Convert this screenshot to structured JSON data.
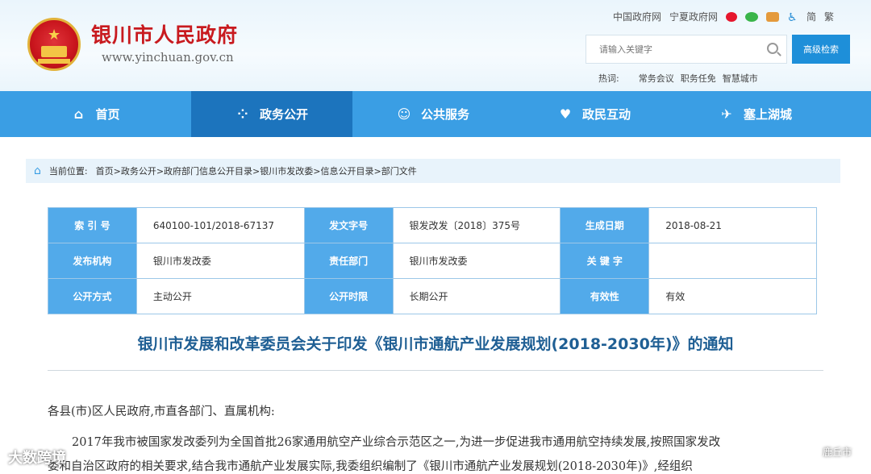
{
  "header": {
    "site_title": "银川市人民政府",
    "site_url": "www.yinchuan.gov.cn",
    "top_links": [
      "中国政府网",
      "宁夏政府网"
    ],
    "lang_simplified": "简",
    "lang_traditional": "繁",
    "search_placeholder": "请输入关键字",
    "advanced_search": "高级检索",
    "hot_label": "热词:",
    "hot_words": [
      "常务会议",
      "职务任免",
      "智慧城市"
    ]
  },
  "nav": {
    "items": [
      {
        "label": "首页",
        "icon": "home-icon"
      },
      {
        "label": "政务公开",
        "icon": "dots-icon",
        "active": true
      },
      {
        "label": "公共服务",
        "icon": "user-icon"
      },
      {
        "label": "政民互动",
        "icon": "heart-hands-icon"
      },
      {
        "label": "塞上湖城",
        "icon": "plane-icon"
      }
    ]
  },
  "breadcrumb": {
    "label": "当前位置:",
    "path": "首页>政务公开>政府部门信息公开目录>银川市发改委>信息公开目录>部门文件"
  },
  "info_table": {
    "rows": [
      [
        {
          "k": "索 引 号",
          "v": "640100-101/2018-67137"
        },
        {
          "k": "发文字号",
          "v": "银发改发〔2018〕375号"
        },
        {
          "k": "生成日期",
          "v": "2018-08-21"
        }
      ],
      [
        {
          "k": "发布机构",
          "v": "银川市发改委"
        },
        {
          "k": "责任部门",
          "v": "银川市发改委"
        },
        {
          "k": "关 键 字",
          "v": ""
        }
      ],
      [
        {
          "k": "公开方式",
          "v": "主动公开"
        },
        {
          "k": "公开时限",
          "v": "长期公开"
        },
        {
          "k": "有效性",
          "v": "有效"
        }
      ]
    ]
  },
  "document": {
    "title": "银川市发展和改革委员会关于印发《银川市通航产业发展规划(2018-2030年)》的通知",
    "salutation": "各县(市)区人民政府,市直各部门、直属机构:",
    "para1": "2017年我市被国家发改委列为全国首批26家通用航空产业综合示范区之一,为进一步促进我市通用航空持续发展,按照国家发改",
    "para2": "委和自治区政府的相关要求,结合我市通航产业发展实际,我委组织编制了《银川市通航产业发展规划(2018-2030年)》,经组织"
  },
  "watermarks": {
    "left": "大数跨境",
    "right": "鹿丘市"
  },
  "colors": {
    "nav_bg": "#3a9ee4",
    "nav_active": "#1c74bd",
    "title_red": "#c81a1f",
    "table_key_bg": "#52aaea",
    "doc_title": "#1f5f94"
  }
}
